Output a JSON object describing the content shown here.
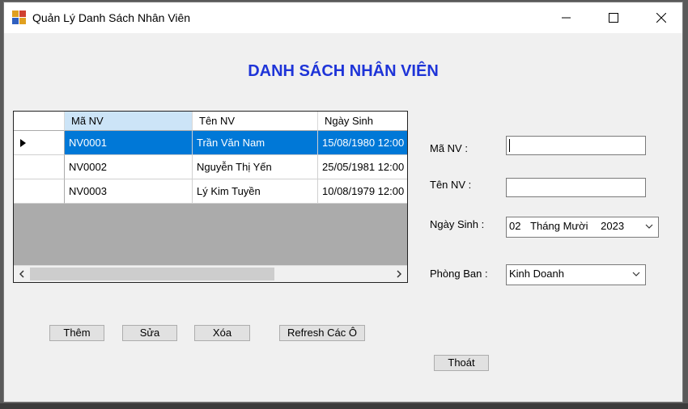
{
  "window": {
    "title": "Quản Lý Danh Sách Nhân Viên",
    "icons": {
      "app": "form-app-icon",
      "minimize": "minimize-icon",
      "maximize": "maximize-icon",
      "close": "close-icon"
    }
  },
  "heading": "DANH SÁCH NHÂN VIÊN",
  "grid": {
    "columns": [
      "Mã NV",
      "Tên NV",
      "Ngày Sinh"
    ],
    "rows": [
      {
        "ma": "NV0001",
        "ten": "Trần Văn Nam",
        "ngay": "15/08/1980 12:00",
        "selected": true
      },
      {
        "ma": "NV0002",
        "ten": "Nguyễn Thị Yến",
        "ngay": "25/05/1981 12:00",
        "selected": false
      },
      {
        "ma": "NV0003",
        "ten": "Lý Kim Tuyền",
        "ngay": "10/08/1979 12:00",
        "selected": false
      }
    ],
    "selection_color": "#0078d7"
  },
  "form": {
    "ma_label": "Mã NV :",
    "ma_value": "",
    "ten_label": "Tên NV :",
    "ten_value": "",
    "ngay_label": "Ngày Sinh :",
    "ngay_day": "02",
    "ngay_month": "Tháng Mười",
    "ngay_year": "2023",
    "phong_label": "Phòng Ban :",
    "phong_value": "Kinh Doanh"
  },
  "buttons": {
    "them": "Thêm",
    "sua": "Sửa",
    "xoa": "Xóa",
    "refresh": "Refresh Các Ô",
    "thoat": "Thoát"
  },
  "colors": {
    "heading": "#1e34d8"
  }
}
